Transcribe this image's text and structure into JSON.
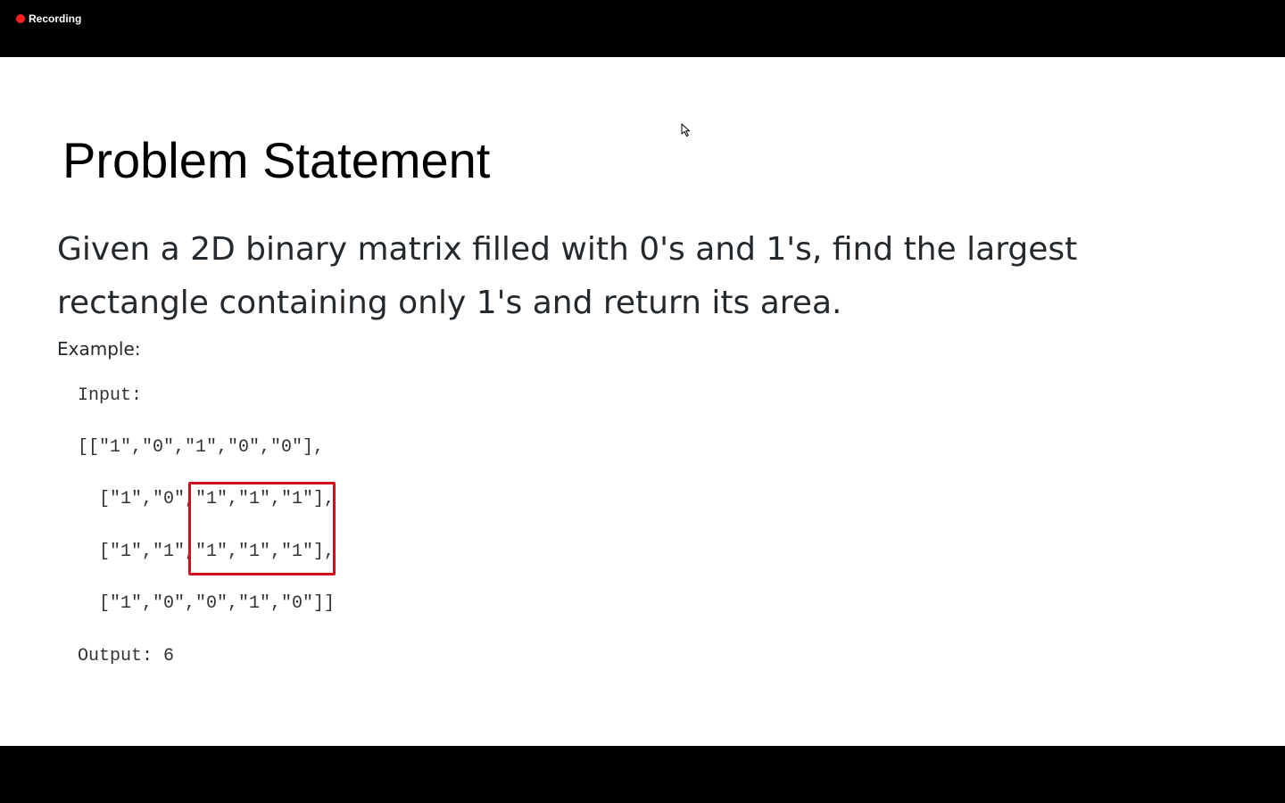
{
  "recording": {
    "label": "Recording",
    "indicator_color": "#ff1f1f"
  },
  "slide": {
    "title": "Problem Statement",
    "description": "Given a 2D binary matrix filled with 0's and 1's, find the largest rectangle containing only 1's and return its area.",
    "example_label": "Example:",
    "code": {
      "input_label": "Input:",
      "matrix_lines": [
        "[[\"1\",\"0\",\"1\",\"0\",\"0\"],",
        "[\"1\",\"0\",\"1\",\"1\",\"1\"],",
        "[\"1\",\"1\",\"1\",\"1\",\"1\"],",
        "[\"1\",\"0\",\"0\",\"1\",\"0\"]]"
      ],
      "output_line": "Output: 6"
    },
    "highlight_color": "#d20f1e"
  },
  "icons": {
    "recording": "record-dot-icon",
    "cursor": "mouse-pointer-icon"
  }
}
